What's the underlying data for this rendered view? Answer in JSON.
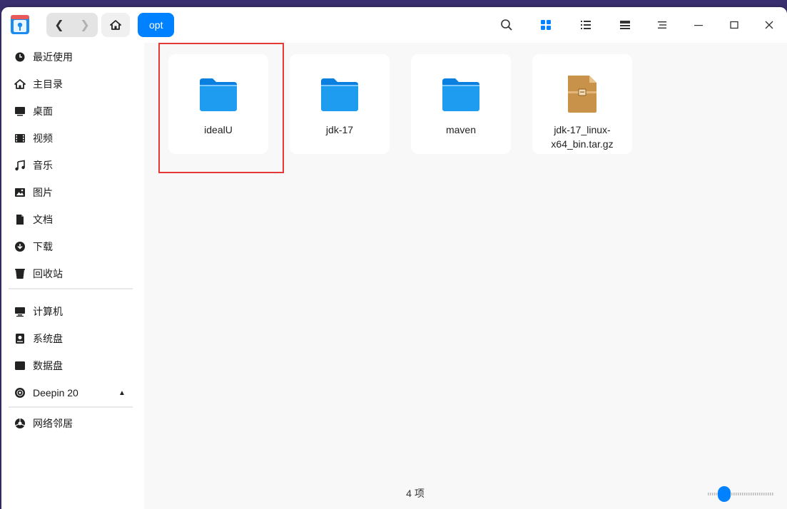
{
  "titlebar": {
    "crumb": "opt",
    "icons": [
      "back-icon",
      "forward-icon",
      "home-icon",
      "search-icon",
      "icon-view-icon",
      "list-view-icon",
      "tree-view-icon",
      "menu-icon",
      "minimize-icon",
      "maximize-icon",
      "close-icon"
    ]
  },
  "sidebar": {
    "items": [
      {
        "label": "最近使用",
        "icon": "clock-icon"
      },
      {
        "label": "主目录",
        "icon": "home-icon"
      },
      {
        "label": "桌面",
        "icon": "desktop-icon"
      },
      {
        "label": "视频",
        "icon": "video-icon"
      },
      {
        "label": "音乐",
        "icon": "music-icon"
      },
      {
        "label": "图片",
        "icon": "picture-icon"
      },
      {
        "label": "文档",
        "icon": "document-icon"
      },
      {
        "label": "下载",
        "icon": "download-icon"
      },
      {
        "label": "回收站",
        "icon": "trash-icon"
      }
    ],
    "devices": [
      {
        "label": "计算机",
        "icon": "computer-icon"
      },
      {
        "label": "系统盘",
        "icon": "disk-icon"
      },
      {
        "label": "数据盘",
        "icon": "disk-icon"
      },
      {
        "label": "Deepin 20",
        "icon": "optical-disc-icon"
      }
    ],
    "network": [
      {
        "label": "网络邻居",
        "icon": "network-icon"
      }
    ]
  },
  "files": [
    {
      "name": "idealU",
      "type": "folder"
    },
    {
      "name": "jdk-17",
      "type": "folder"
    },
    {
      "name": "maven",
      "type": "folder"
    },
    {
      "name": "jdk-17_linux-x64_bin.tar.gz",
      "type": "archive"
    }
  ],
  "status": {
    "count_label": "4 项"
  },
  "colors": {
    "accent": "#0081ff",
    "highlight": "#e53935",
    "folder": "#1e9cf0",
    "archive": "#c8924a"
  }
}
